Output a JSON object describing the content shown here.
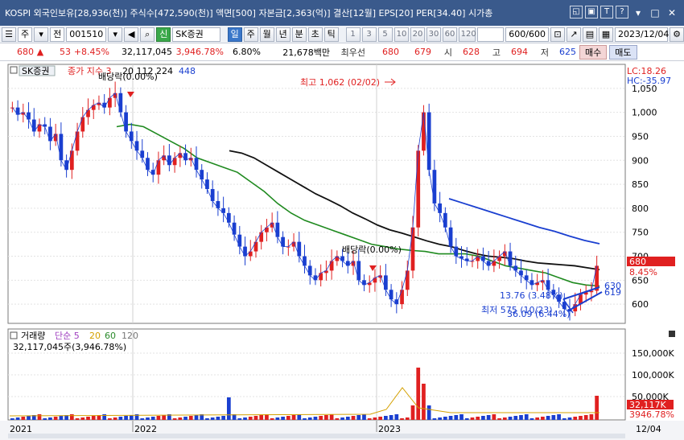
{
  "window": {
    "title": "KOSPI 외국인보유[28,936(천)] 주식수[472,590(천)] 액면[500] 자본금[2,363(억)] 결산[12월] EPS[20] PER[34.40] 시가총",
    "buttons": [
      "◱",
      "▣",
      "T",
      "?"
    ],
    "controls": [
      "▾",
      "□",
      "✕"
    ]
  },
  "toolbar": {
    "market": "주",
    "prev": "전",
    "code": "001510",
    "sin_badge": "신",
    "stock_name": "SK증권",
    "periods": [
      "일",
      "주",
      "월",
      "년",
      "분",
      "초",
      "틱"
    ],
    "active_period": "일",
    "intervals": [
      "1",
      "3",
      "5",
      "10",
      "20",
      "30",
      "60",
      "120"
    ],
    "count": "600/600",
    "date": "2023/12/04"
  },
  "price_info": {
    "price": "680",
    "change": "53",
    "change_pct": "+8.45%",
    "volume": "32,117,045",
    "volume_ratio": "3,946.78%",
    "turnover": "6.80%",
    "amount": "21,678백만",
    "best_ask_label": "최우선",
    "best_ask": "680",
    "best_bid": "679",
    "open_label": "시",
    "open": "628",
    "high_label": "고",
    "high": "694",
    "low_label": "저",
    "low": "625",
    "buy_label": "매수",
    "sell_label": "매도"
  },
  "chart_data": {
    "type": "candlestick",
    "price_panel": {
      "legend": {
        "name": "SK증권",
        "ma_label": "종가 지수 3",
        "ma_periods": "20 112 224",
        "ma_last": "448"
      },
      "lc": "LC:18.26",
      "hc": "HC:-35.97",
      "ylim": [
        560,
        1100
      ],
      "yticks": [
        600,
        650,
        700,
        750,
        800,
        850,
        900,
        950,
        1000,
        1050
      ],
      "annotations": {
        "high": "최고 1,062 (02/02)",
        "low": "최저 575 (10/23)",
        "dividend1": "배당락(0.00%)",
        "dividend2": "배당락(0.00%)",
        "gain1": "13.76 (3.48%)",
        "gain2": "36.09 (6.44%)",
        "level1": "630",
        "level2": "619"
      },
      "current_price": "680",
      "current_pct": "8.45%",
      "close_series": [
        1010,
        995,
        1000,
        985,
        960,
        975,
        970,
        940,
        955,
        900,
        880,
        920,
        960,
        990,
        1005,
        1015,
        1020,
        1010,
        1030,
        1040,
        1000,
        960,
        940,
        920,
        905,
        880,
        870,
        900,
        910,
        890,
        905,
        915,
        900,
        905,
        880,
        860,
        840,
        815,
        800,
        790,
        770,
        745,
        720,
        700,
        710,
        730,
        750,
        760,
        770,
        740,
        720,
        720,
        730,
        700,
        680,
        660,
        650,
        665,
        670,
        690,
        700,
        690,
        680,
        690,
        650,
        640,
        645,
        655,
        660,
        630,
        610,
        600,
        630,
        670,
        760,
        920,
        1000,
        880,
        810,
        790,
        760,
        720,
        700,
        695,
        690,
        690,
        700,
        690,
        680,
        690,
        700,
        710,
        680,
        670,
        660,
        650,
        640,
        645,
        650,
        630,
        620,
        605,
        590,
        585,
        600,
        620,
        625,
        628,
        680
      ],
      "ma_black": [
        920,
        915,
        905,
        890,
        875,
        860,
        845,
        830,
        818,
        805,
        790,
        778,
        765,
        755,
        748,
        740,
        732,
        725,
        720,
        712,
        705,
        700,
        698,
        695,
        690,
        686,
        684,
        682,
        680,
        676,
        672
      ],
      "ma_green": [
        970,
        975,
        970,
        955,
        940,
        925,
        905,
        895,
        885,
        875,
        855,
        835,
        810,
        790,
        775,
        765,
        755,
        745,
        735,
        725,
        720,
        715,
        712,
        710,
        705,
        705,
        705,
        700,
        690,
        680,
        675,
        670,
        665,
        655,
        645,
        640,
        638
      ],
      "ma_blue": [
        820,
        810,
        800,
        790,
        780,
        770,
        760,
        752,
        742,
        733,
        726
      ]
    },
    "volume_panel": {
      "legend": {
        "label": "거래량",
        "ma_label": "단순 5",
        "p1": "20",
        "p2": "60",
        "p3": "120",
        "volume_text": "32,117,045주(3,946.78%)"
      },
      "yticks": [
        "50,000K",
        "100,000K",
        "150,000K"
      ],
      "current": "32,117K",
      "current_pct": "3946.78%"
    },
    "x_axis": [
      "2021",
      "2022",
      "2023",
      "12/04"
    ]
  }
}
